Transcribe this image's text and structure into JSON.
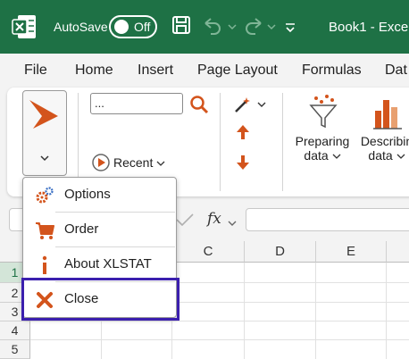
{
  "titlebar": {
    "autosave_label": "AutoSave",
    "autosave_state": "Off",
    "title": "Book1 - Exce"
  },
  "tabs": [
    "File",
    "Home",
    "Insert",
    "Page Layout",
    "Formulas",
    "Dat"
  ],
  "ribbon": {
    "search_value": "...",
    "recent_label": "Recent",
    "preparing_data": [
      "Preparing",
      "data"
    ],
    "describing_data": [
      "Describin",
      "data"
    ]
  },
  "formula_bar": {
    "fx": "fx"
  },
  "grid": {
    "columns": [
      "C",
      "D",
      "E"
    ],
    "rows": [
      "1",
      "2",
      "3",
      "4",
      "5"
    ]
  },
  "menu": {
    "items": [
      {
        "label": "Options",
        "icon": "gears-icon"
      },
      {
        "label": "Order",
        "icon": "cart-icon"
      },
      {
        "label": "About XLSTAT",
        "icon": "info-icon"
      },
      {
        "label": "Close",
        "icon": "close-x-icon"
      }
    ]
  },
  "colors": {
    "titlebar": "#1e7145",
    "accent_orange": "#d3541c",
    "highlight": "#3b1fae"
  }
}
